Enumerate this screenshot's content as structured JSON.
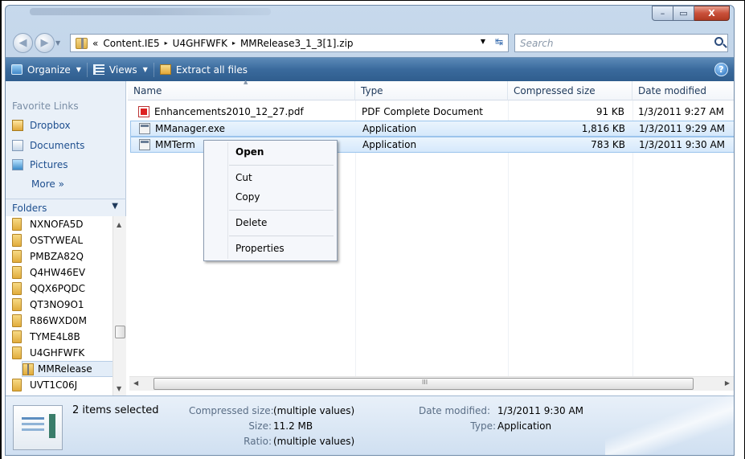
{
  "window": {
    "caption_buttons": {
      "minimize": "–",
      "maximize": "▭",
      "close": "X"
    }
  },
  "address_bar": {
    "overflow": "«",
    "segments": [
      "Content.IE5",
      "U4GHFWFK",
      "MMRelease3_1_3[1].zip"
    ],
    "separator": "▸"
  },
  "search": {
    "placeholder": "Search"
  },
  "toolbar": {
    "organize": "Organize",
    "views": "Views",
    "extract": "Extract all files",
    "help": "?"
  },
  "nav_pane": {
    "favorite_links_title": "Favorite Links",
    "favorites": [
      "Dropbox",
      "Documents",
      "Pictures"
    ],
    "more": "More »",
    "folders_title": "Folders",
    "tree": [
      "NXNOFA5D",
      "OSTYWEAL",
      "PMBZA82Q",
      "Q4HW46EV",
      "QQX6PQDC",
      "QT3NO9O1",
      "R86WXD0M",
      "TYME4L8B",
      "U4GHFWFK",
      "MMRelease",
      "UVT1C06J"
    ]
  },
  "file_list": {
    "columns": [
      "Name",
      "Type",
      "Compressed size",
      "Date modified"
    ],
    "rows": [
      {
        "name": "Enhancements2010_12_27.pdf",
        "type": "PDF Complete Document",
        "size": "91 KB",
        "date": "1/3/2011 9:27 AM",
        "selected": false
      },
      {
        "name": "MManager.exe",
        "type": "Application",
        "size": "1,816 KB",
        "date": "1/3/2011 9:29 AM",
        "selected": true
      },
      {
        "name": "MMTerm",
        "type": "Application",
        "size": "783 KB",
        "date": "1/3/2011 9:30 AM",
        "selected": true
      }
    ],
    "hscroll_grip": "III"
  },
  "context_menu": {
    "items": [
      "Open",
      "Cut",
      "Copy",
      "Delete",
      "Properties"
    ]
  },
  "details": {
    "count": "2 items selected",
    "compressed_size_label": "Compressed size:",
    "compressed_size_value": "(multiple values)",
    "size_label": "Size:",
    "size_value": "11.2 MB",
    "ratio_label": "Ratio:",
    "ratio_value": "(multiple values)",
    "date_label": "Date modified:",
    "date_value": "1/3/2011 9:30 AM",
    "type_label": "Type:",
    "type_value": "Application"
  },
  "colors": {
    "toolbar": "#3a6a9c",
    "selection": "#d5e8fb",
    "link": "#1e4f8f"
  }
}
